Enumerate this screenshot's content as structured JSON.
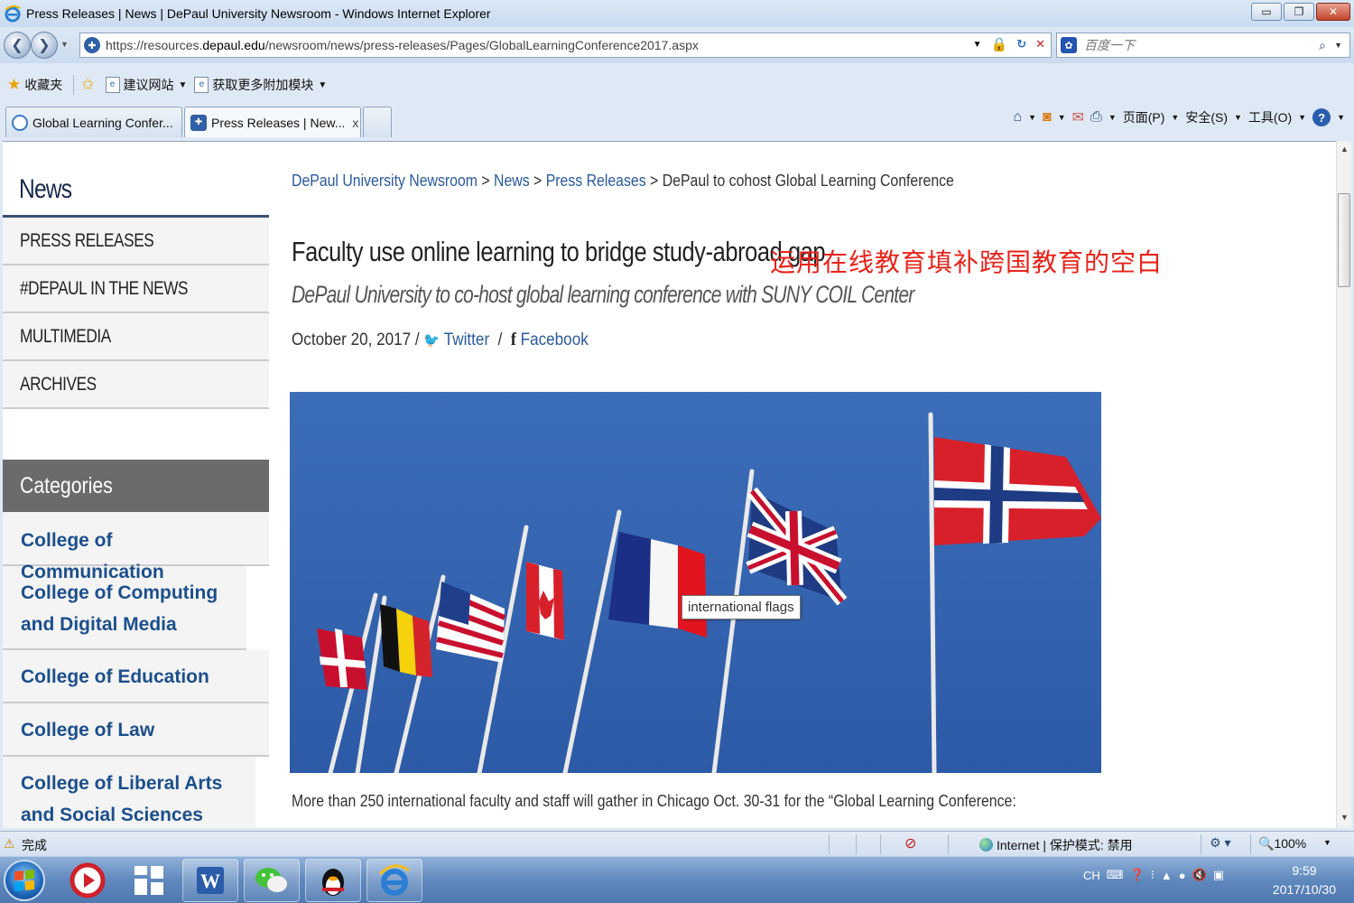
{
  "window": {
    "title": "Press Releases | News | DePaul University Newsroom - Windows Internet Explorer",
    "minimize": "▭",
    "restore": "❐",
    "close": "✕"
  },
  "address": {
    "url_prefix": "https://resources.",
    "url_domain": "depaul.edu",
    "url_path": "/newsroom/news/press-releases/Pages/GlobalLearningConference2017.aspx",
    "search_placeholder": "百度一下"
  },
  "favorites": {
    "favorites_label": "收藏夹",
    "suggested_sites": "建议网站",
    "more_addons": "获取更多附加模块"
  },
  "tabs": [
    {
      "label": "Global Learning Confer..."
    },
    {
      "label": "Press Releases | New...",
      "close": "x"
    }
  ],
  "commandbar": {
    "page": "页面(P)",
    "safety": "安全(S)",
    "tools": "工具(O)",
    "help": "?"
  },
  "leftnav": {
    "heading": "News",
    "items": [
      "PRESS RELEASES",
      "#DEPAUL IN THE NEWS",
      "MULTIMEDIA",
      "ARCHIVES"
    ],
    "categories_heading": "Categories",
    "categories": [
      "College of Communication",
      "College of Computing and Digital Media",
      "College of Education",
      "College of Law",
      "College of Liberal Arts and Social Sciences"
    ]
  },
  "article": {
    "breadcrumb": {
      "home": "DePaul University Newsroom",
      "news": "News",
      "press": "Press Releases",
      "current": "DePaul to cohost Global Learning Conference",
      "sep": " > "
    },
    "headline": "Faculty use online learning to bridge study-abroad gap",
    "headline_annotation": "运用在线教育填补跨国教育的空白",
    "subhead": "DePaul University to co-host global learning conference with SUNY COIL Center",
    "date": "October 20, 2017 /",
    "twitter": "Twitter",
    "facebook": "Facebook",
    "slash": "/",
    "image_tooltip": "international flags",
    "body_start": "More than 250 international faculty and staff will gather in Chicago Oct. 30-31 for the “Global Learning Conference:"
  },
  "status": {
    "text": "完成",
    "zone": "Internet | 保护模式: 禁用",
    "zoom": "100%"
  },
  "taskbar": {
    "tray_lang": "CH",
    "time": "9:59",
    "date": "2017/10/30"
  }
}
